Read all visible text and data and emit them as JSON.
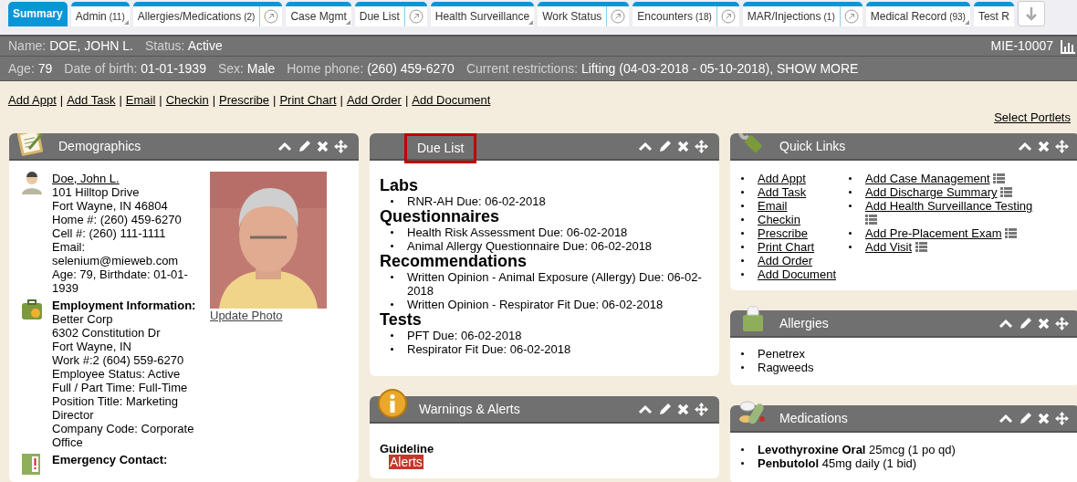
{
  "tabs": [
    {
      "label": "Summary",
      "selected": true,
      "menu": false,
      "popout": false
    },
    {
      "label": "Admin",
      "count": "(11)",
      "selected": false,
      "menu": true,
      "popout": false
    },
    {
      "label": "Allergies/Medications",
      "count": "(2)",
      "selected": false,
      "menu": false,
      "popout": true
    },
    {
      "label": "Case Mgmt",
      "selected": false,
      "menu": true,
      "popout": false
    },
    {
      "label": "Due List",
      "selected": false,
      "menu": false,
      "popout": true
    },
    {
      "label": "Health Surveillance",
      "selected": false,
      "menu": true,
      "popout": false
    },
    {
      "label": "Work Status",
      "selected": false,
      "menu": false,
      "popout": true
    },
    {
      "label": "Encounters",
      "count": "(18)",
      "selected": false,
      "menu": false,
      "popout": true
    },
    {
      "label": "MAR/Injections",
      "count": "(1)",
      "selected": false,
      "menu": false,
      "popout": true
    },
    {
      "label": "Medical Record",
      "count": "(93)",
      "selected": false,
      "menu": true,
      "popout": false
    },
    {
      "label": "Test R",
      "selected": false,
      "menu": false,
      "popout": false
    }
  ],
  "patient_bar": {
    "fields": [
      {
        "label": "Name:",
        "value": "DOE, JOHN L."
      },
      {
        "label": "Status:",
        "value": "Active"
      }
    ],
    "record_id": "MIE-10007"
  },
  "details_bar": {
    "fields": [
      {
        "label": "Age:",
        "value": "79"
      },
      {
        "label": "Date of birth:",
        "value": "01-01-1939"
      },
      {
        "label": "Sex:",
        "value": "Male"
      },
      {
        "label": "Home phone:",
        "value": "(260) 459-6270"
      },
      {
        "label": "Current restrictions:",
        "value": "Lifting (04-03-2018 - 05-10-2018), SHOW MORE"
      }
    ]
  },
  "action_links": [
    "Add Appt",
    "Add Task",
    "Email",
    "Checkin",
    "Prescribe",
    "Print Chart",
    "Add Order",
    "Add Document"
  ],
  "link_separator": "|",
  "select_portlets": "Select Portlets",
  "columns": [
    [
      {
        "kind": "demographics",
        "title": "Demographics",
        "editable": true,
        "outlined": false,
        "sections": [
          {
            "kind": "person",
            "link": "Doe, John L.",
            "lines": [
              "101 Hilltop Drive",
              "Fort Wayne, IN 46804",
              "Home #: (260) 459-6270",
              "Cell #: (260) 111-1111",
              "Email: selenium@mieweb.com",
              "Age: 79, Birthdate: 01-01-1939"
            ]
          },
          {
            "kind": "employment",
            "heading": "Employment Information:",
            "lines": [
              "Better Corp",
              "6302 Constitution Dr",
              "Fort Wayne, IN",
              "Work #:2 (604) 559-6270",
              "Employee Status: Active",
              "Full / Part Time: Full-Time",
              "Position Title: Marketing Director",
              "Company Code: Corporate Office"
            ]
          },
          {
            "kind": "emergency",
            "heading": "Emergency Contact:"
          }
        ],
        "photo": {
          "link": "Update Photo"
        }
      }
    ],
    [
      {
        "kind": "due_list",
        "title": "Due List",
        "editable": true,
        "outlined": true,
        "groups": [
          {
            "heading": "Labs",
            "items": [
              "RNR-AH Due: 06-02-2018"
            ]
          },
          {
            "heading": "Questionnaires",
            "items": [
              "Health Risk Assessment Due: 06-02-2018",
              "Animal Allergy Questionnaire Due: 06-02-2018"
            ]
          },
          {
            "heading": "Recommendations",
            "items": [
              "Written Opinion - Animal Exposure (Allergy) Due: 06-02-2018",
              "Written Opinion - Respirator Fit Due: 06-02-2018"
            ]
          },
          {
            "heading": "Tests",
            "items": [
              "PFT Due: 06-02-2018",
              "Respirator Fit Due: 06-02-2018"
            ]
          }
        ]
      },
      {
        "kind": "warnings",
        "title": "Warnings & Alerts",
        "editable": true,
        "outlined": false,
        "heading": "Guideline",
        "badge": "Alerts"
      }
    ],
    [
      {
        "kind": "quick_links",
        "title": "Quick Links",
        "editable": false,
        "outlined": false,
        "link_columns": [
          [
            {
              "label": "Add Appt",
              "list_icon": false
            },
            {
              "label": "Add Task",
              "list_icon": false
            },
            {
              "label": "Email",
              "list_icon": false
            },
            {
              "label": "Checkin",
              "list_icon": false
            },
            {
              "label": "Prescribe",
              "list_icon": false
            },
            {
              "label": "Print Chart",
              "list_icon": false
            },
            {
              "label": "Add Order",
              "list_icon": false
            },
            {
              "label": "Add Document",
              "list_icon": false
            }
          ],
          [
            {
              "label": "Add Case Management",
              "list_icon": true
            },
            {
              "label": "Add Discharge Summary",
              "list_icon": true
            },
            {
              "label": "Add Health Surveillance Testing",
              "list_icon": true
            },
            {
              "label": "Add Pre-Placement Exam",
              "list_icon": true
            },
            {
              "label": "Add Visit",
              "list_icon": true
            }
          ]
        ]
      },
      {
        "kind": "allergies",
        "title": "Allergies",
        "editable": true,
        "outlined": false,
        "items": [
          "Penetrex",
          "Ragweeds"
        ]
      },
      {
        "kind": "medications",
        "title": "Medications",
        "editable": true,
        "outlined": false,
        "items": [
          "**Levothyroxine Oral** 25mcg (1 po qd)",
          "**Penbutolol** 45mg daily (1 bid)"
        ]
      }
    ]
  ]
}
